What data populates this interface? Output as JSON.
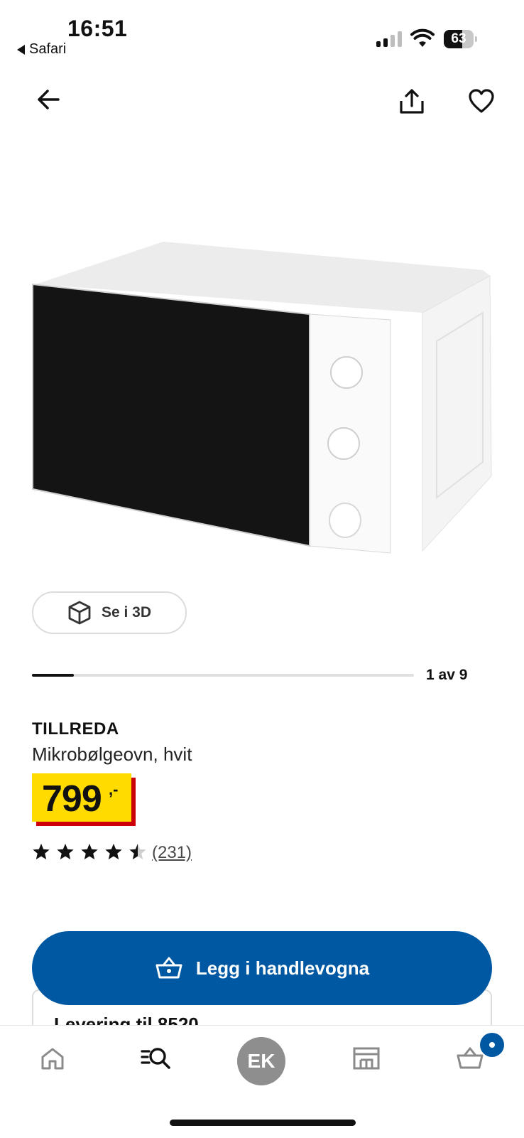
{
  "status_bar": {
    "time": "16:51",
    "back_app": "Safari",
    "battery": "63",
    "battery_level": 0.63,
    "signal_bars_active": 2,
    "icons": [
      "signal-icon",
      "wifi-icon",
      "battery-icon"
    ]
  },
  "top_nav": {
    "icons": [
      "back-arrow-icon",
      "share-icon",
      "heart-icon"
    ]
  },
  "gallery": {
    "view_3d_label": "Se i 3D",
    "counter": "1 av 9",
    "progress": 0.11
  },
  "product": {
    "brand": "TILLREDA",
    "description": "Mikrobølgeovn, hvit",
    "price_main": "799",
    "price_suffix": ",-",
    "rating": 4.5,
    "reviews": "(231)"
  },
  "cta": {
    "add_to_cart": "Legg i handlevogna",
    "delivery_partial": "Levering til 8520"
  },
  "tabbar": {
    "avatar_initials": "EK",
    "icons": [
      "home-icon",
      "search-icon",
      "avatar",
      "store-icon",
      "cart-icon"
    ]
  },
  "colors": {
    "primary_blue": "#0058a3",
    "price_yellow": "#ffdb00",
    "price_red": "#cc0008",
    "avatar_gray": "#8e8e8e"
  }
}
